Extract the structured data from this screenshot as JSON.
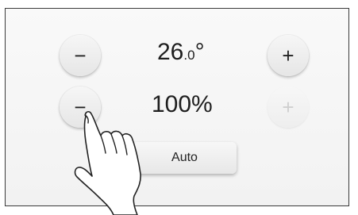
{
  "temperature": {
    "integer": "26",
    "decimal": ".0",
    "unit": "°",
    "decrease_label": "−",
    "increase_label": "+"
  },
  "fan": {
    "value": "100%",
    "decrease_label": "−",
    "increase_label": "+",
    "increase_state": "disabled"
  },
  "mode": {
    "auto_label": "Auto"
  },
  "icons": {
    "touch": "hand-pointer-icon"
  },
  "colors": {
    "panel_border": "#3a3a3a",
    "panel_background": "#f5f5f5",
    "text": "#1e1e1e",
    "disabled_text": "#cfcfcf"
  }
}
